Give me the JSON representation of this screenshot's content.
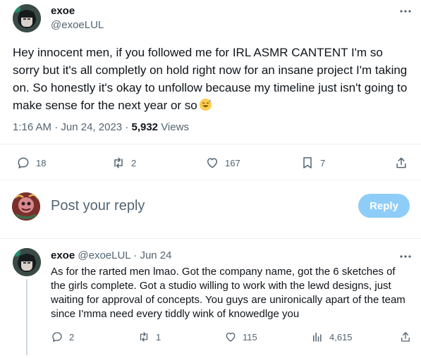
{
  "tweet": {
    "author_name": "exoe",
    "author_handle": "@exoeLUL",
    "text": "Hey innocent men, if you followed me for IRL ASMR CANTENT I'm so sorry but it's all completly on hold right now for an insane project I'm taking on. So honestly it's okay to unfollow because my timeline just isn't going to make sense for the next year or so",
    "emoji": "sweat-smile-emoji",
    "time": "1:16 AM",
    "date": "Jun 24, 2023",
    "separator": "·",
    "views_count": "5,932",
    "views_label": "Views",
    "actions": {
      "replies": "18",
      "retweets": "2",
      "likes": "167",
      "bookmarks": "7"
    }
  },
  "compose": {
    "placeholder": "Post your reply",
    "button_label": "Reply"
  },
  "reply": {
    "author_name": "exoe",
    "author_handle": "@exoeLUL",
    "separator": "·",
    "date": "Jun 24",
    "text": "As for the rarted men lmao. Got the company name, got the 6 sketches of the girls complete. Got a studio willing to work with the lewd designs, just waiting for approval of concepts. You guys are unironically apart of the team since I'mma need every tiddly wink of knowedlge you",
    "actions": {
      "replies": "2",
      "retweets": "1",
      "likes": "115",
      "views": "4,615"
    }
  },
  "colors": {
    "text_primary": "#0f1419",
    "text_secondary": "#536471",
    "reply_button_disabled": "#8ecdf8",
    "divider": "#eff3f4"
  }
}
